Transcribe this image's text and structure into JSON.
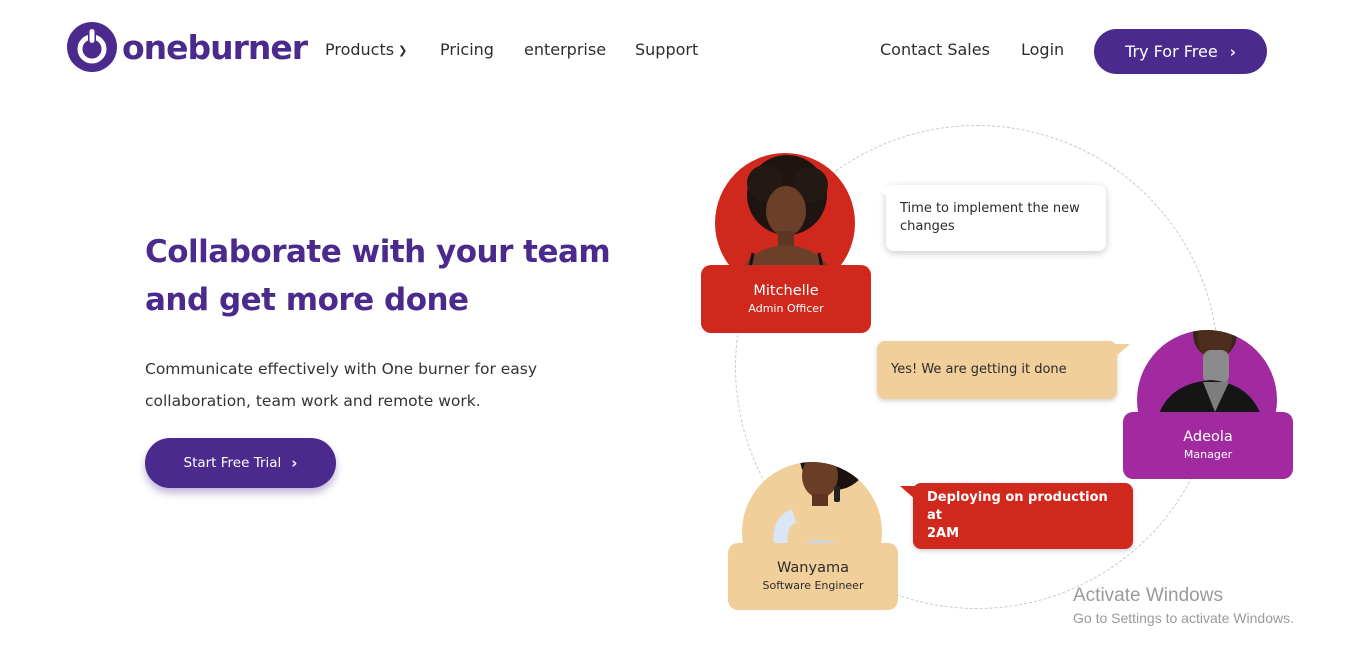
{
  "brand": {
    "name": "oneburner",
    "color": "#4a2a8c"
  },
  "nav": {
    "products": "Products",
    "pricing": "Pricing",
    "enterprise": "enterprise",
    "support": "Support",
    "contact_sales": "Contact Sales",
    "login": "Login",
    "try_free": "Try For Free"
  },
  "hero": {
    "title_line1": "Collaborate with your team",
    "title_line2": "and get more done",
    "subtitle_line1": "Communicate effectively with One burner for easy",
    "subtitle_line2": "collaboration, team work and remote work.",
    "cta": "Start Free Trial"
  },
  "illustration": {
    "people": [
      {
        "name": "Mitchelle",
        "role": "Admin Officer",
        "color": "#d0281d"
      },
      {
        "name": "Adeola",
        "role": "Manager",
        "color": "#a22aa0"
      },
      {
        "name": "Wanyama",
        "role": "Software Engineer",
        "color": "#f0cf9b"
      }
    ],
    "messages": [
      {
        "text_line1": "Time to implement the new",
        "text_line2": "changes"
      },
      {
        "text": "Yes! We are getting it done"
      },
      {
        "text_line1": "Deploying on production at",
        "text_line2": "2AM"
      }
    ]
  },
  "watermark": {
    "title": "Activate Windows",
    "subtitle": "Go to Settings to activate Windows."
  },
  "icons": {
    "logo": "power-ring-logo-icon",
    "dropdown": "chevron-down-icon",
    "arrow": "chevron-right-icon"
  }
}
